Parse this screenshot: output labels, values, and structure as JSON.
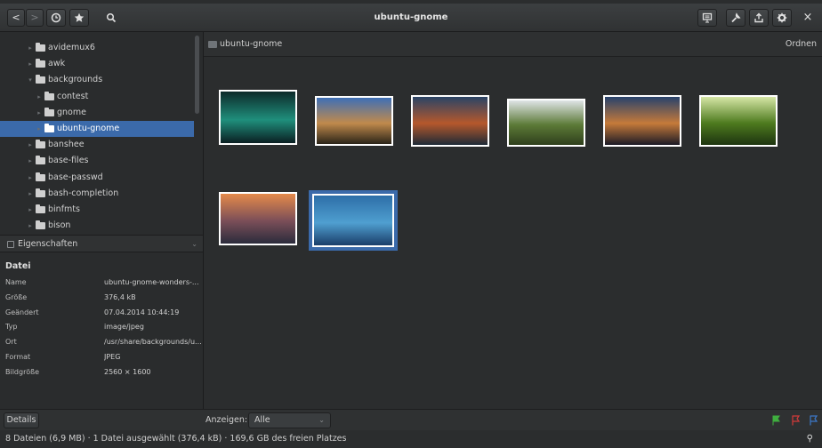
{
  "window": {
    "title": "ubuntu-gnome"
  },
  "toolbar": {
    "back_glyph": "<",
    "forward_glyph": ">",
    "close_glyph": "×"
  },
  "tree": {
    "items": [
      {
        "label": "avidemux6",
        "level": 1,
        "expanded": false,
        "selected": false
      },
      {
        "label": "awk",
        "level": 1,
        "expanded": false,
        "selected": false
      },
      {
        "label": "backgrounds",
        "level": 1,
        "expanded": true,
        "selected": false
      },
      {
        "label": "contest",
        "level": 2,
        "expanded": false,
        "selected": false
      },
      {
        "label": "gnome",
        "level": 2,
        "expanded": false,
        "selected": false
      },
      {
        "label": "ubuntu-gnome",
        "level": 2,
        "expanded": false,
        "selected": true
      },
      {
        "label": "banshee",
        "level": 1,
        "expanded": false,
        "selected": false
      },
      {
        "label": "base-files",
        "level": 1,
        "expanded": false,
        "selected": false
      },
      {
        "label": "base-passwd",
        "level": 1,
        "expanded": false,
        "selected": false
      },
      {
        "label": "bash-completion",
        "level": 1,
        "expanded": false,
        "selected": false
      },
      {
        "label": "binfmts",
        "level": 1,
        "expanded": false,
        "selected": false
      },
      {
        "label": "bison",
        "level": 1,
        "expanded": false,
        "selected": false
      }
    ]
  },
  "properties": {
    "header": "Eigenschaften",
    "section": "Datei",
    "rows": [
      {
        "key": "Name",
        "value": "ubuntu-gnome-wonders-..."
      },
      {
        "key": "Größe",
        "value": "376,4 kB"
      },
      {
        "key": "Geändert",
        "value": "07.04.2014 10:44:19"
      },
      {
        "key": "Typ",
        "value": "image/jpeg"
      },
      {
        "key": "Ort",
        "value": "/usr/share/backgrounds/u..."
      },
      {
        "key": "Format",
        "value": "JPEG"
      },
      {
        "key": "Bildgröße",
        "value": "2560 × 1600"
      }
    ]
  },
  "pathbar": {
    "path": "ubuntu-gnome",
    "sort_label": "Ordnen"
  },
  "thumbnails": [
    {
      "name": "aurora-thumb",
      "colors": [
        "#0d2a2a",
        "#1f8f7c",
        "#0b1f22"
      ],
      "selected": false
    },
    {
      "name": "castle-thumb",
      "colors": [
        "#3e6fb6",
        "#c08a4c",
        "#2a2418"
      ],
      "selected": false
    },
    {
      "name": "tower-thumb",
      "colors": [
        "#2a4466",
        "#b5582c",
        "#1e2a36"
      ],
      "selected": false
    },
    {
      "name": "valley-thumb",
      "colors": [
        "#dfe4e6",
        "#5c7a37",
        "#2f3f1c"
      ],
      "selected": false
    },
    {
      "name": "town-night-thumb",
      "colors": [
        "#27426c",
        "#c57a3a",
        "#1b1a26"
      ],
      "selected": false
    },
    {
      "name": "palm-leaves-thumb",
      "colors": [
        "#d6e6a6",
        "#4d7a1e",
        "#1e3410"
      ],
      "selected": false
    },
    {
      "name": "eiffel-thumb",
      "colors": [
        "#e58a4a",
        "#7a4e58",
        "#2b2c3c"
      ],
      "selected": false
    },
    {
      "name": "blue-wave-thumb",
      "colors": [
        "#2d6ea8",
        "#4f9fd0",
        "#1b3e6a"
      ],
      "selected": true
    }
  ],
  "footer": {
    "details_label": "Details",
    "show_label": "Anzeigen:",
    "filter_value": "Alle",
    "flag_colors": [
      "#3fae3f",
      "#d23a3a",
      "#3c78c8"
    ]
  },
  "status": {
    "text": "8 Dateien (6,9 MB) · 1 Datei ausgewählt (376,4 kB) · 169,6 GB des freien Platzes"
  }
}
